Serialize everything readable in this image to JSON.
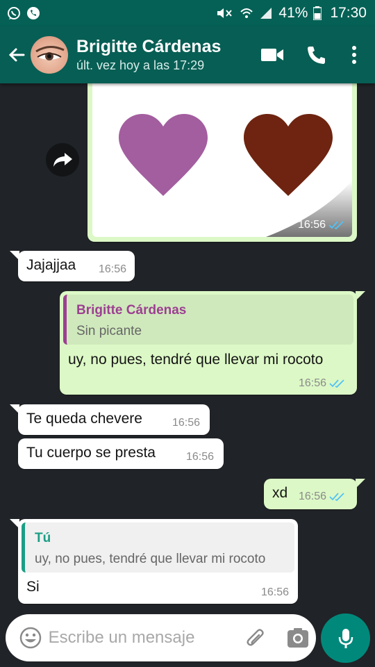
{
  "status_bar": {
    "battery": "41%",
    "time": "17:30"
  },
  "header": {
    "contact_name": "Brigitte Cárdenas",
    "last_seen": "últ. vez hoy a las 17:29"
  },
  "colors": {
    "header": "#075e54",
    "outgoing": "#dcf8c6",
    "incoming": "#ffffff",
    "chat_bg": "#202327",
    "read_ticks": "#4fc3f7",
    "quote_purple": "#9d3f92",
    "quote_teal": "#1b9e85"
  },
  "messages": [
    {
      "id": "img",
      "direction": "out",
      "type": "image",
      "time": "16:56",
      "status": "read"
    },
    {
      "id": "m1",
      "direction": "in",
      "text": "Jajajjaa",
      "time": "16:56"
    },
    {
      "id": "m2",
      "direction": "out",
      "quote": {
        "author": "Brigitte Cárdenas",
        "text": "Sin picante"
      },
      "text": "uy, no pues, tendré que llevar mi rocoto",
      "time": "16:56",
      "status": "read"
    },
    {
      "id": "m3",
      "direction": "in",
      "text": "Te queda chevere",
      "time": "16:56"
    },
    {
      "id": "m4",
      "direction": "in",
      "text": "Tu cuerpo se presta",
      "time": "16:56"
    },
    {
      "id": "m5",
      "direction": "out",
      "text": "xd",
      "time": "16:56",
      "status": "read"
    },
    {
      "id": "m6",
      "direction": "in",
      "quote": {
        "author": "Tú",
        "text": "uy, no pues, tendré que llevar mi rocoto"
      },
      "text": "Si",
      "time": "16:56"
    }
  ],
  "composer": {
    "placeholder": "Escribe un mensaje"
  },
  "icons": {
    "statusbar_left": [
      "whatsapp-icon",
      "phone-icon"
    ],
    "statusbar_right": [
      "mute-icon",
      "wifi-icon",
      "signal-icon",
      "battery-icon"
    ],
    "header": [
      "back-arrow-icon",
      "video-call-icon",
      "phone-call-icon",
      "more-vert-icon"
    ],
    "composer": [
      "emoji-icon",
      "attach-icon",
      "camera-icon",
      "mic-icon"
    ],
    "forward": "forward-icon"
  }
}
